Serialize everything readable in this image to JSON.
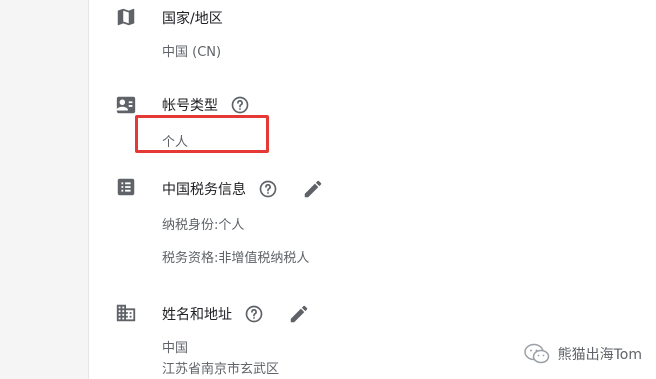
{
  "country_section": {
    "icon": "map-icon",
    "title": "国家/地区",
    "value": "中国 (CN)"
  },
  "account_type_section": {
    "icon": "account-card-icon",
    "title": "帐号类型",
    "value": "个人",
    "highlight_color": "#e53935"
  },
  "tax_info_section": {
    "icon": "list-icon",
    "title": "中国税务信息",
    "line1": "纳税身份:个人",
    "line2": "税务资格:非增值税纳税人"
  },
  "name_address_section": {
    "icon": "building-icon",
    "title": "姓名和地址",
    "line1": "中国",
    "line2": "江苏省南京市玄武区"
  },
  "watermark": {
    "icon": "wechat-icon",
    "text": "熊猫出海Tom"
  }
}
